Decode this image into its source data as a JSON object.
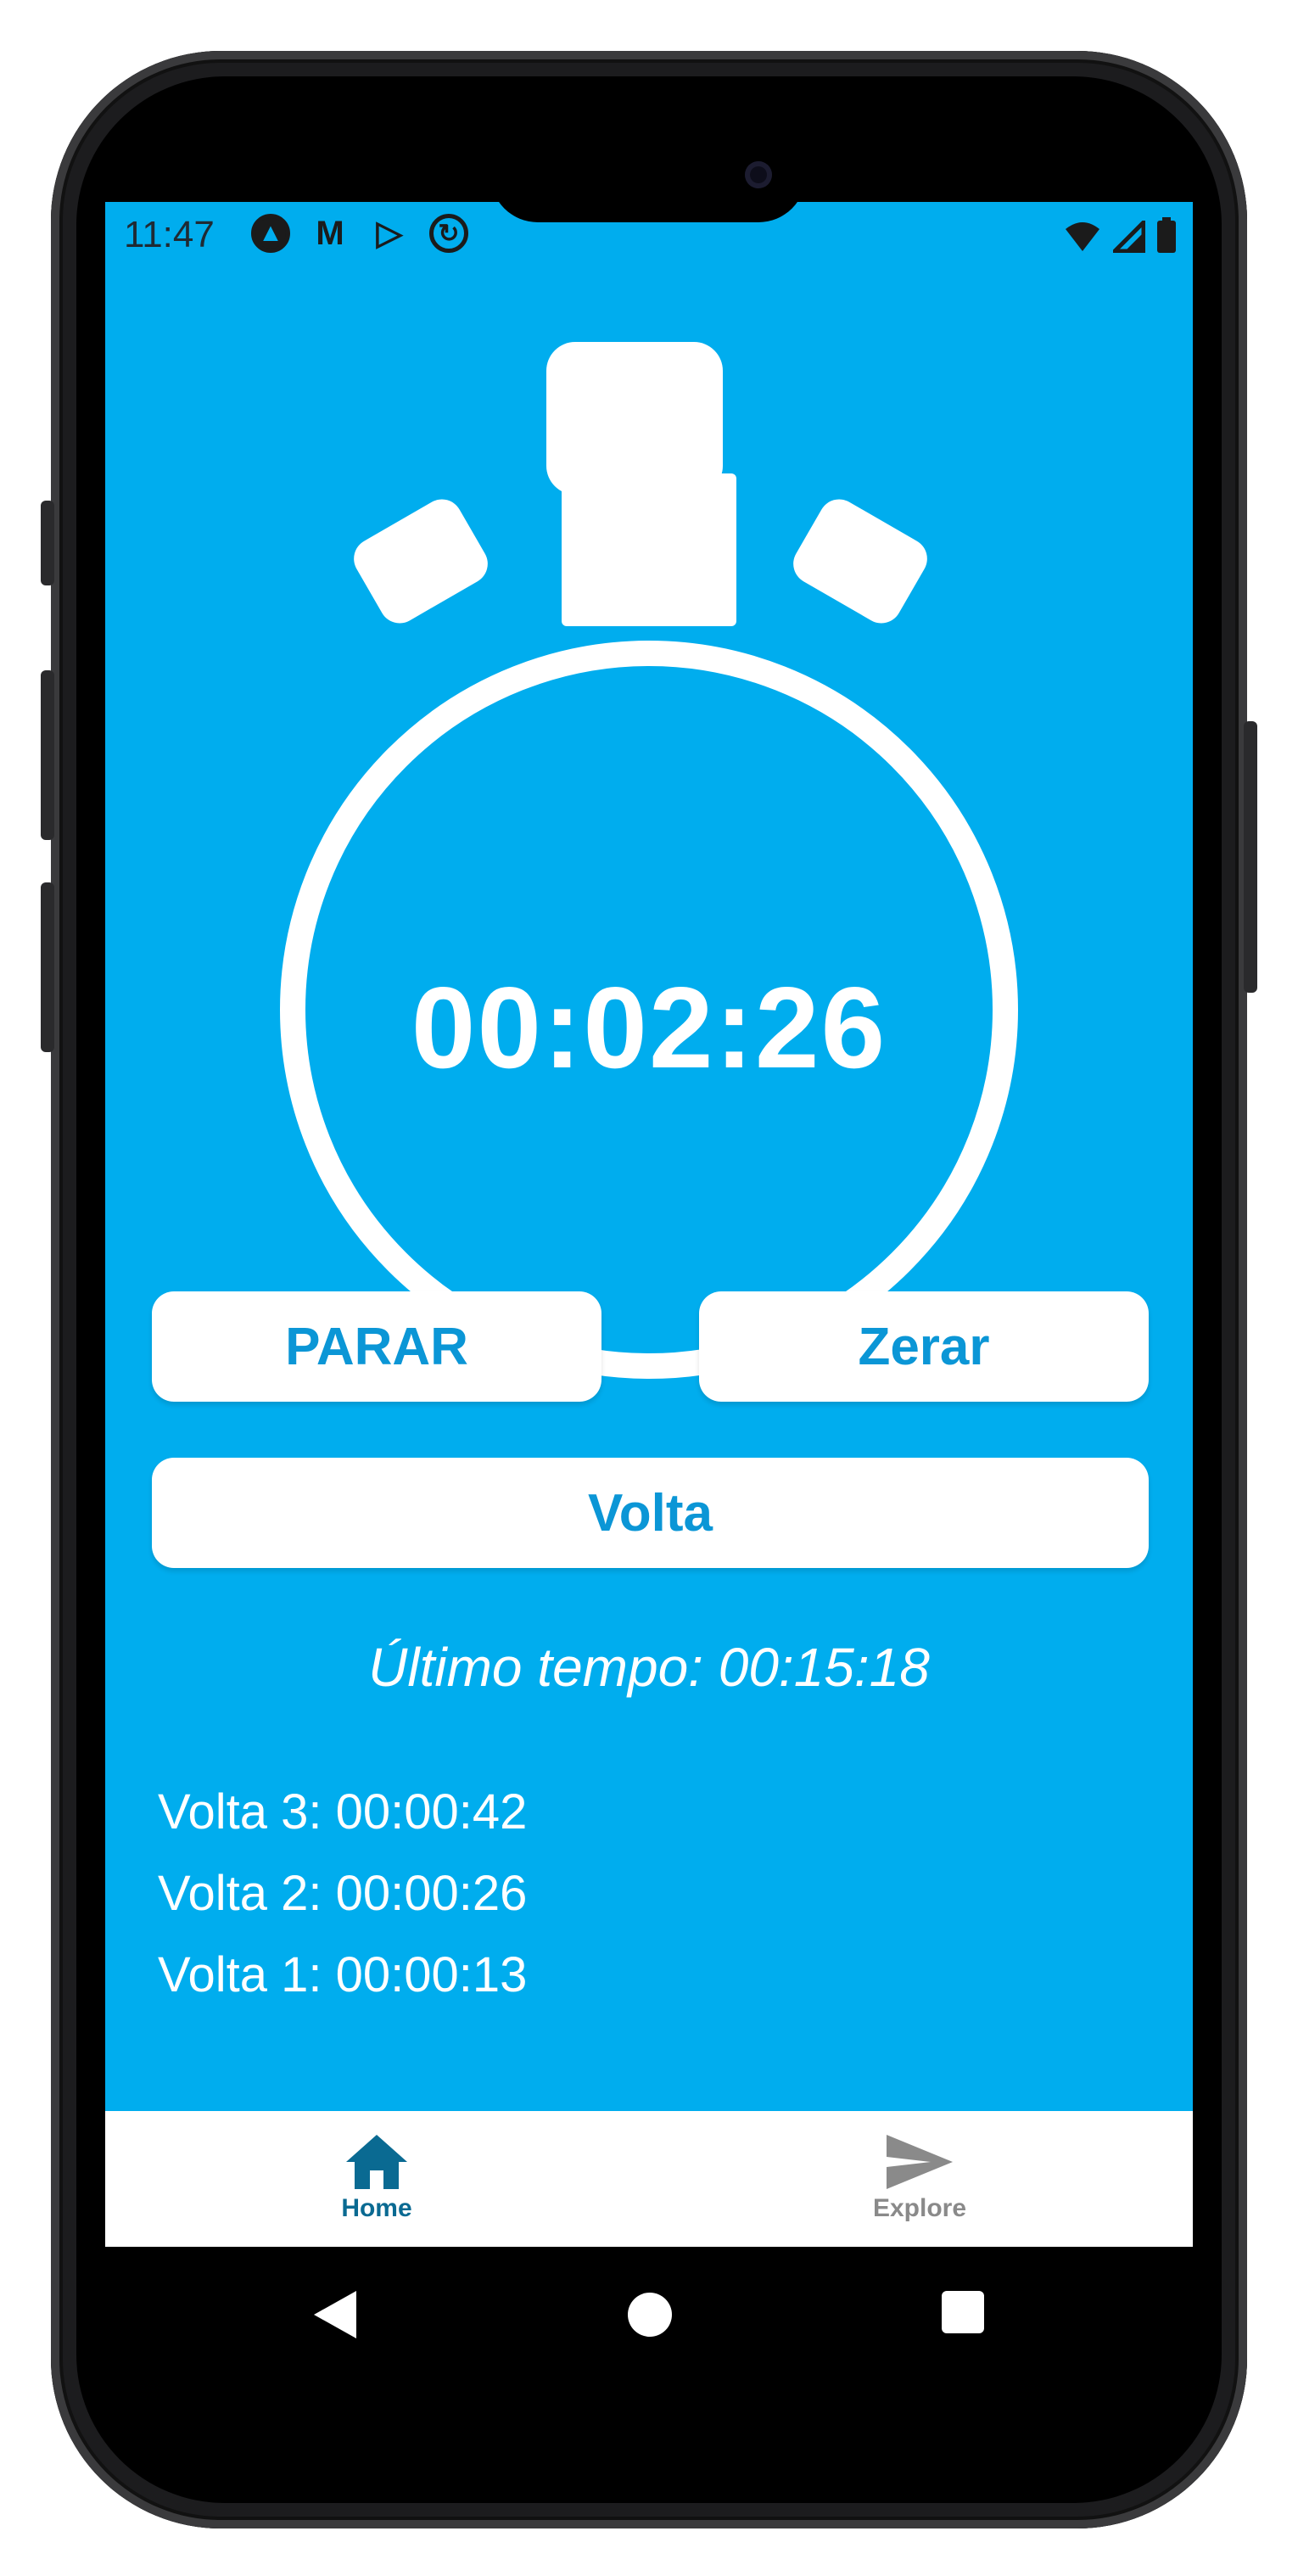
{
  "status_bar": {
    "time": "11:47",
    "notification_icons": [
      "android-auto-icon",
      "gmail-icon",
      "play-store-icon",
      "sync-icon"
    ],
    "system_icons": [
      "wifi-icon",
      "signal-icon",
      "battery-icon"
    ]
  },
  "stopwatch": {
    "display": "00:02:26"
  },
  "buttons": {
    "stop": "PARAR",
    "reset": "Zerar",
    "lap": "Volta"
  },
  "last_time": "Último tempo: 00:15:18",
  "laps": [
    "Volta 3: 00:00:42",
    "Volta 2: 00:00:26",
    "Volta 1: 00:00:13"
  ],
  "tab_bar": {
    "tabs": [
      {
        "label": "Home",
        "icon": "home-icon",
        "active": true
      },
      {
        "label": "Explore",
        "icon": "send-icon",
        "active": false
      }
    ]
  },
  "nav_bar": {
    "buttons": [
      "back-icon",
      "home-circle-icon",
      "recents-icon"
    ]
  },
  "colors": {
    "accent": "#00adee",
    "button_text": "#0b96d6",
    "active_tab": "#0a6a92",
    "inactive_tab": "#8a8a8a"
  }
}
